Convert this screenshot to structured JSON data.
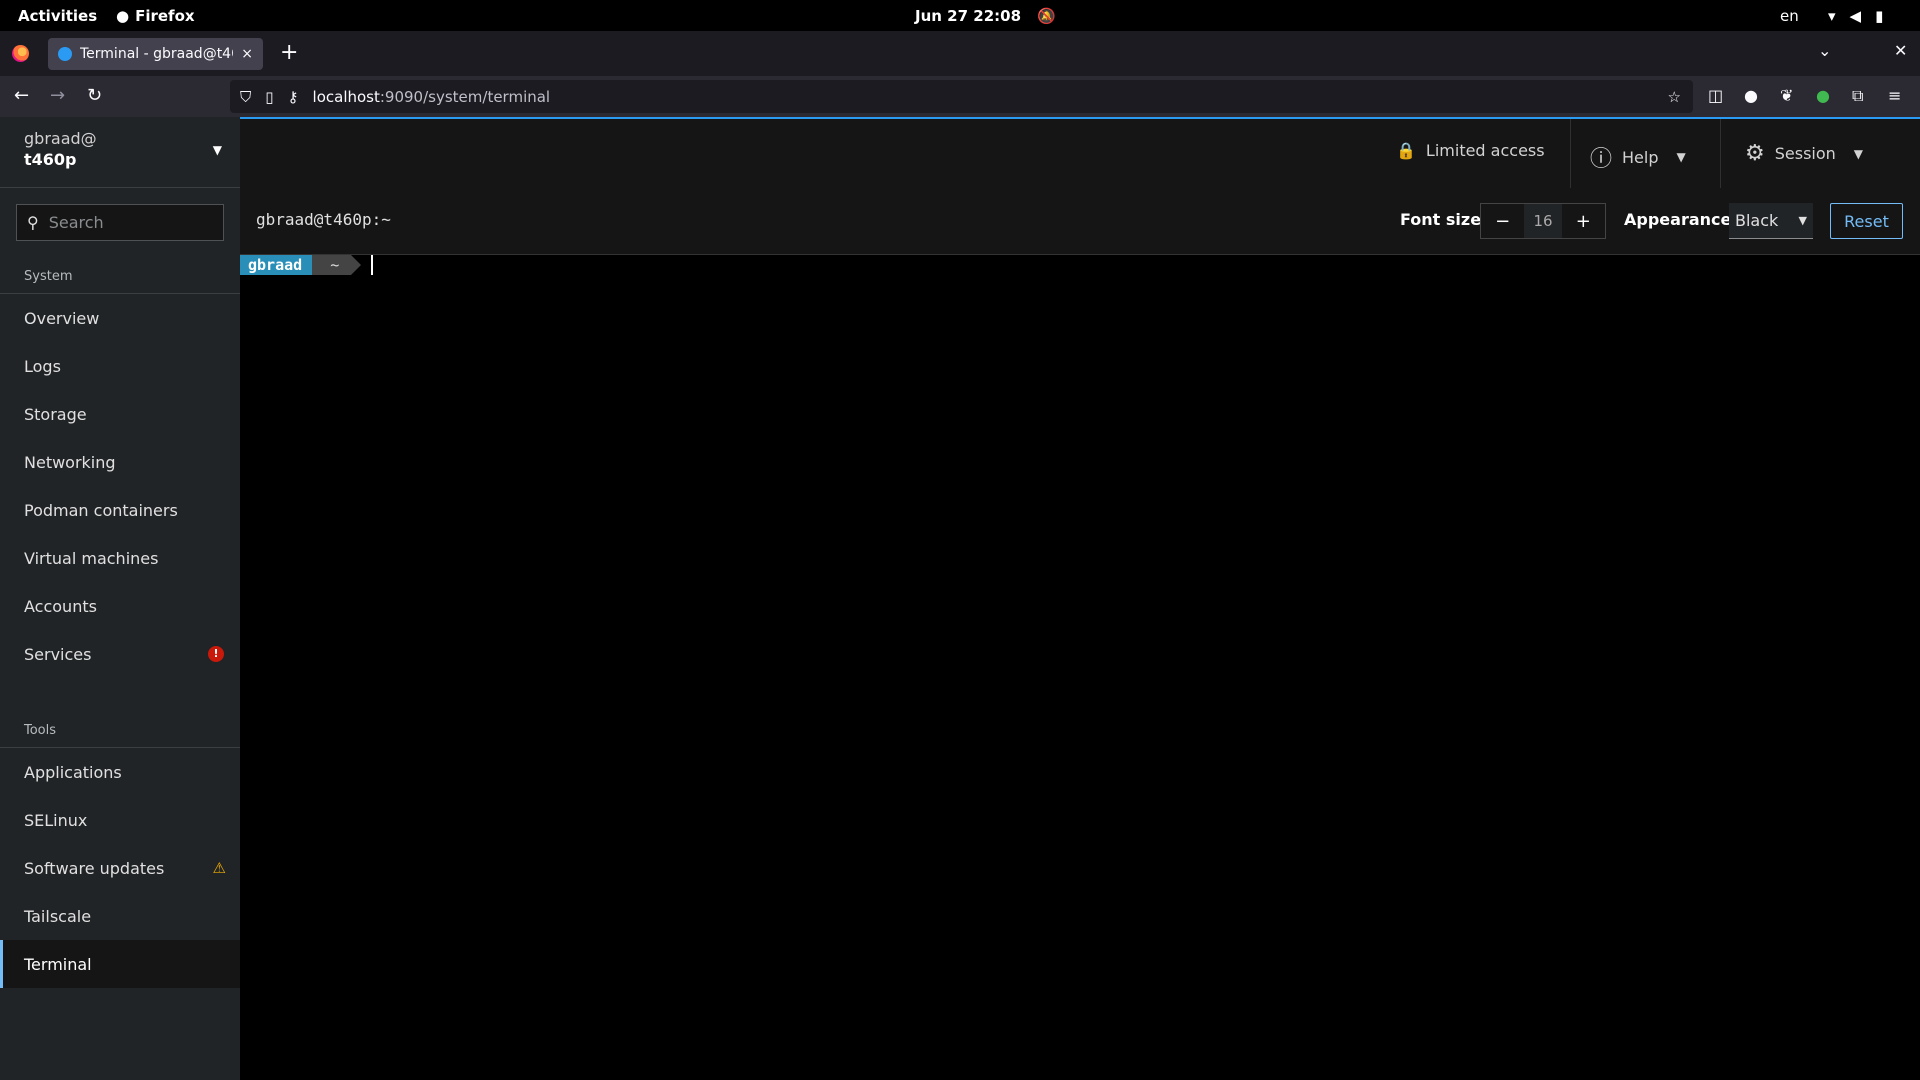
{
  "gnome": {
    "activities": "Activities",
    "app_name": "Firefox",
    "clock": "Jun 27  22:08",
    "lang": "en"
  },
  "browser": {
    "tab_title": "Terminal - gbraad@t460p",
    "tab_close": "×",
    "new_tab": "+",
    "url_host": "localhost",
    "url_path": ":9090/system/terminal"
  },
  "sidebar": {
    "user": "gbraad@",
    "host": "t460p",
    "search_placeholder": "Search",
    "system_title": "System",
    "system_items": [
      {
        "label": "Overview"
      },
      {
        "label": "Logs"
      },
      {
        "label": "Storage"
      },
      {
        "label": "Networking"
      },
      {
        "label": "Podman containers"
      },
      {
        "label": "Virtual machines"
      },
      {
        "label": "Accounts"
      },
      {
        "label": "Services",
        "badge": "!"
      }
    ],
    "tools_title": "Tools",
    "tools_items": [
      {
        "label": "Applications"
      },
      {
        "label": "SELinux"
      },
      {
        "label": "Software updates",
        "warn": "⚠"
      },
      {
        "label": "Tailscale"
      },
      {
        "label": "Terminal"
      }
    ]
  },
  "masthead": {
    "limited_access": "Limited access",
    "help": "Help",
    "session": "Session"
  },
  "terminal_toolbar": {
    "title": "gbraad@t460p:~",
    "font_size_label": "Font size",
    "font_size_value": "16",
    "minus": "−",
    "plus": "+",
    "appearance_label": "Appearance",
    "appearance_value": "Black",
    "reset": "Reset"
  },
  "terminal": {
    "prompt_user": "gbraad",
    "prompt_dir": "~"
  }
}
